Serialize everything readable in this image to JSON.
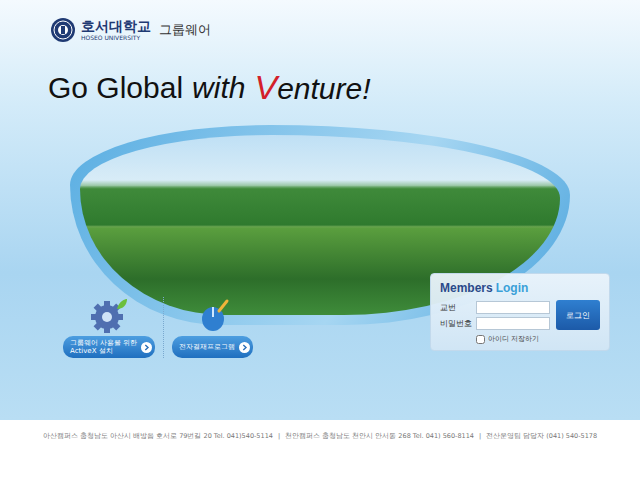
{
  "header": {
    "university": "호서대학교",
    "university_en": "HOSEO UNIVERSITY",
    "system": "그룹웨어"
  },
  "slogan": {
    "lead": "Go Global",
    "with": "with",
    "mark": "V",
    "rest": "enture!"
  },
  "shortcuts": [
    {
      "lines": [
        "그룹웨어 사용을 위한",
        "ActiveX 설치"
      ]
    },
    {
      "lines": [
        "전자결재프로그램"
      ]
    }
  ],
  "login": {
    "title_first": "Members",
    "title_second": "Login",
    "fields": [
      {
        "label": "교번",
        "value": ""
      },
      {
        "label": "비밀번호",
        "value": ""
      }
    ],
    "button": "로그인",
    "remember": {
      "label": "아이디 저장하기",
      "checked": false
    }
  },
  "footer": {
    "separator": "|",
    "items": [
      "아산캠퍼스 충청남도 아산시 배방읍 호서로 79번길 20 Tel. 041)540-5114",
      "천안캠퍼스 충청남도 천안시 안서동 268 Tel. 041) 560-8114",
      "전산운영팀 담당자 (041) 540-5178"
    ]
  }
}
